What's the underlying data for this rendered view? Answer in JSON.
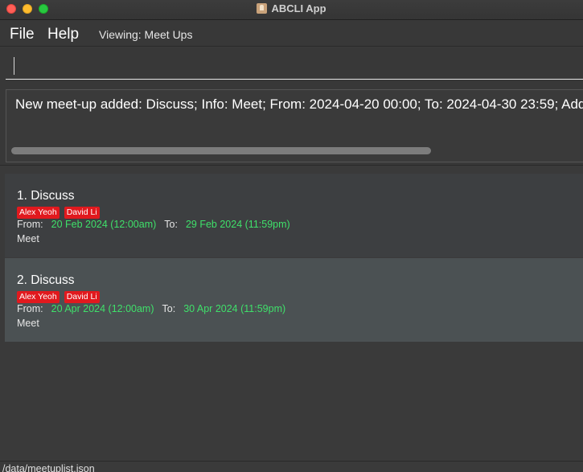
{
  "window": {
    "title": "ABCLI App",
    "icon": "app-icon"
  },
  "menu": {
    "file": "File",
    "help": "Help",
    "viewing": "Viewing: Meet Ups"
  },
  "command": {
    "value": "",
    "placeholder": ""
  },
  "result": {
    "message": "New meet-up added: Discuss; Info: Meet; From: 2024-04-20 00:00; To: 2024-04-30 23:59; Add"
  },
  "meetups": [
    {
      "title": "1. Discuss",
      "tags": [
        "Alex Yeoh",
        "David Li"
      ],
      "from_label": "From:",
      "from": "20 Feb 2024 (12:00am)",
      "to_label": "To:",
      "to": "29 Feb 2024 (11:59pm)",
      "info": "Meet"
    },
    {
      "title": "2. Discuss",
      "tags": [
        "Alex Yeoh",
        "David Li"
      ],
      "from_label": "From:",
      "from": "20 Apr 2024 (12:00am)",
      "to_label": "To:",
      "to": "30 Apr 2024 (11:59pm)",
      "info": "Meet"
    }
  ],
  "status": {
    "path": "/data/meetuplist.json"
  },
  "colors": {
    "background": "#3a3a3a",
    "tag": "#e1191e",
    "datetime": "#3fe06a",
    "selected_card": "#4b5153"
  }
}
